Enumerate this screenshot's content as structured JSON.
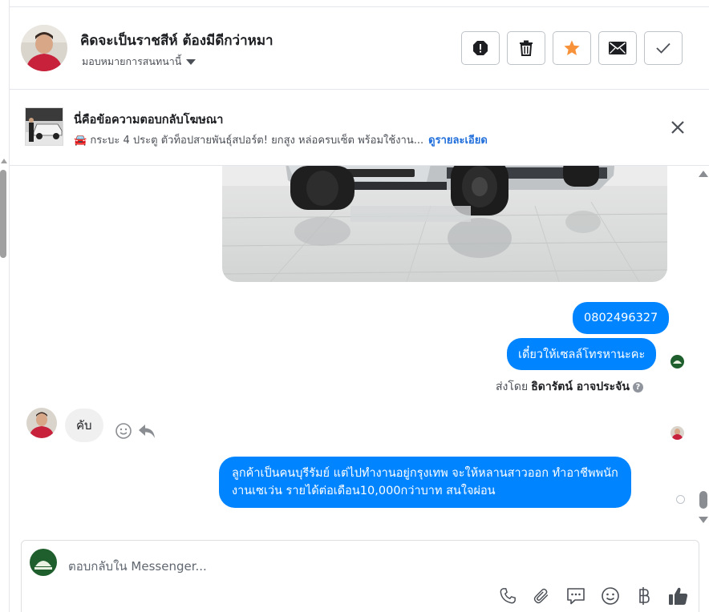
{
  "header": {
    "contact_name": "คิดจะเป็นราชสีห์ ต้องมีดีกว่าหมา",
    "assign_label": "มอบหมายการสนทนานี้",
    "actions": [
      "spam-icon",
      "trash-icon",
      "star-icon",
      "envelope-icon",
      "check-icon"
    ],
    "star_color": "#f7923a"
  },
  "ad": {
    "title": "นี่คือข้อความตอบกลับโฆษณา",
    "description": "🚘 กระบะ 4 ประตู ตัวท็อปสายพันธุ์สปอร์ต! ยกสูง หล่อครบเซ็ต พร้อมใช้งาน...",
    "details_link": "ดูรายละเอียด"
  },
  "messages": {
    "phone_bubble": "0802496327",
    "sales_call_bubble": "เดี๋ยวให้เซลล์โทรหานะคะ",
    "sent_by_prefix": "ส่งโดย",
    "sent_by_name": "ธิดารัตน์ อาจประจัน",
    "incoming_reply": "คับ",
    "customer_info_line1": "ลูกค้าเป็นคนบุรีรัมย์ แต่ไปทำงานอยู่กรุงเทพ จะให้หลานสาวออก ทำอาชีพพนัก",
    "customer_info_line2": "งานเซเว่น รายได้ต่อเดือน10,000กว่าบาท สนใจผ่อน"
  },
  "composer": {
    "placeholder": "ตอบกลับใน Messenger...",
    "tools": [
      "phone-icon",
      "paperclip-icon",
      "saved-replies-icon",
      "emoji-icon",
      "baht-icon",
      "thumbs-up-icon"
    ]
  },
  "colors": {
    "outgoing_bubble": "#0084ff",
    "incoming_bubble": "#f1f0f0",
    "link": "#216fdb",
    "thumbs_up": "#4b4f56"
  }
}
